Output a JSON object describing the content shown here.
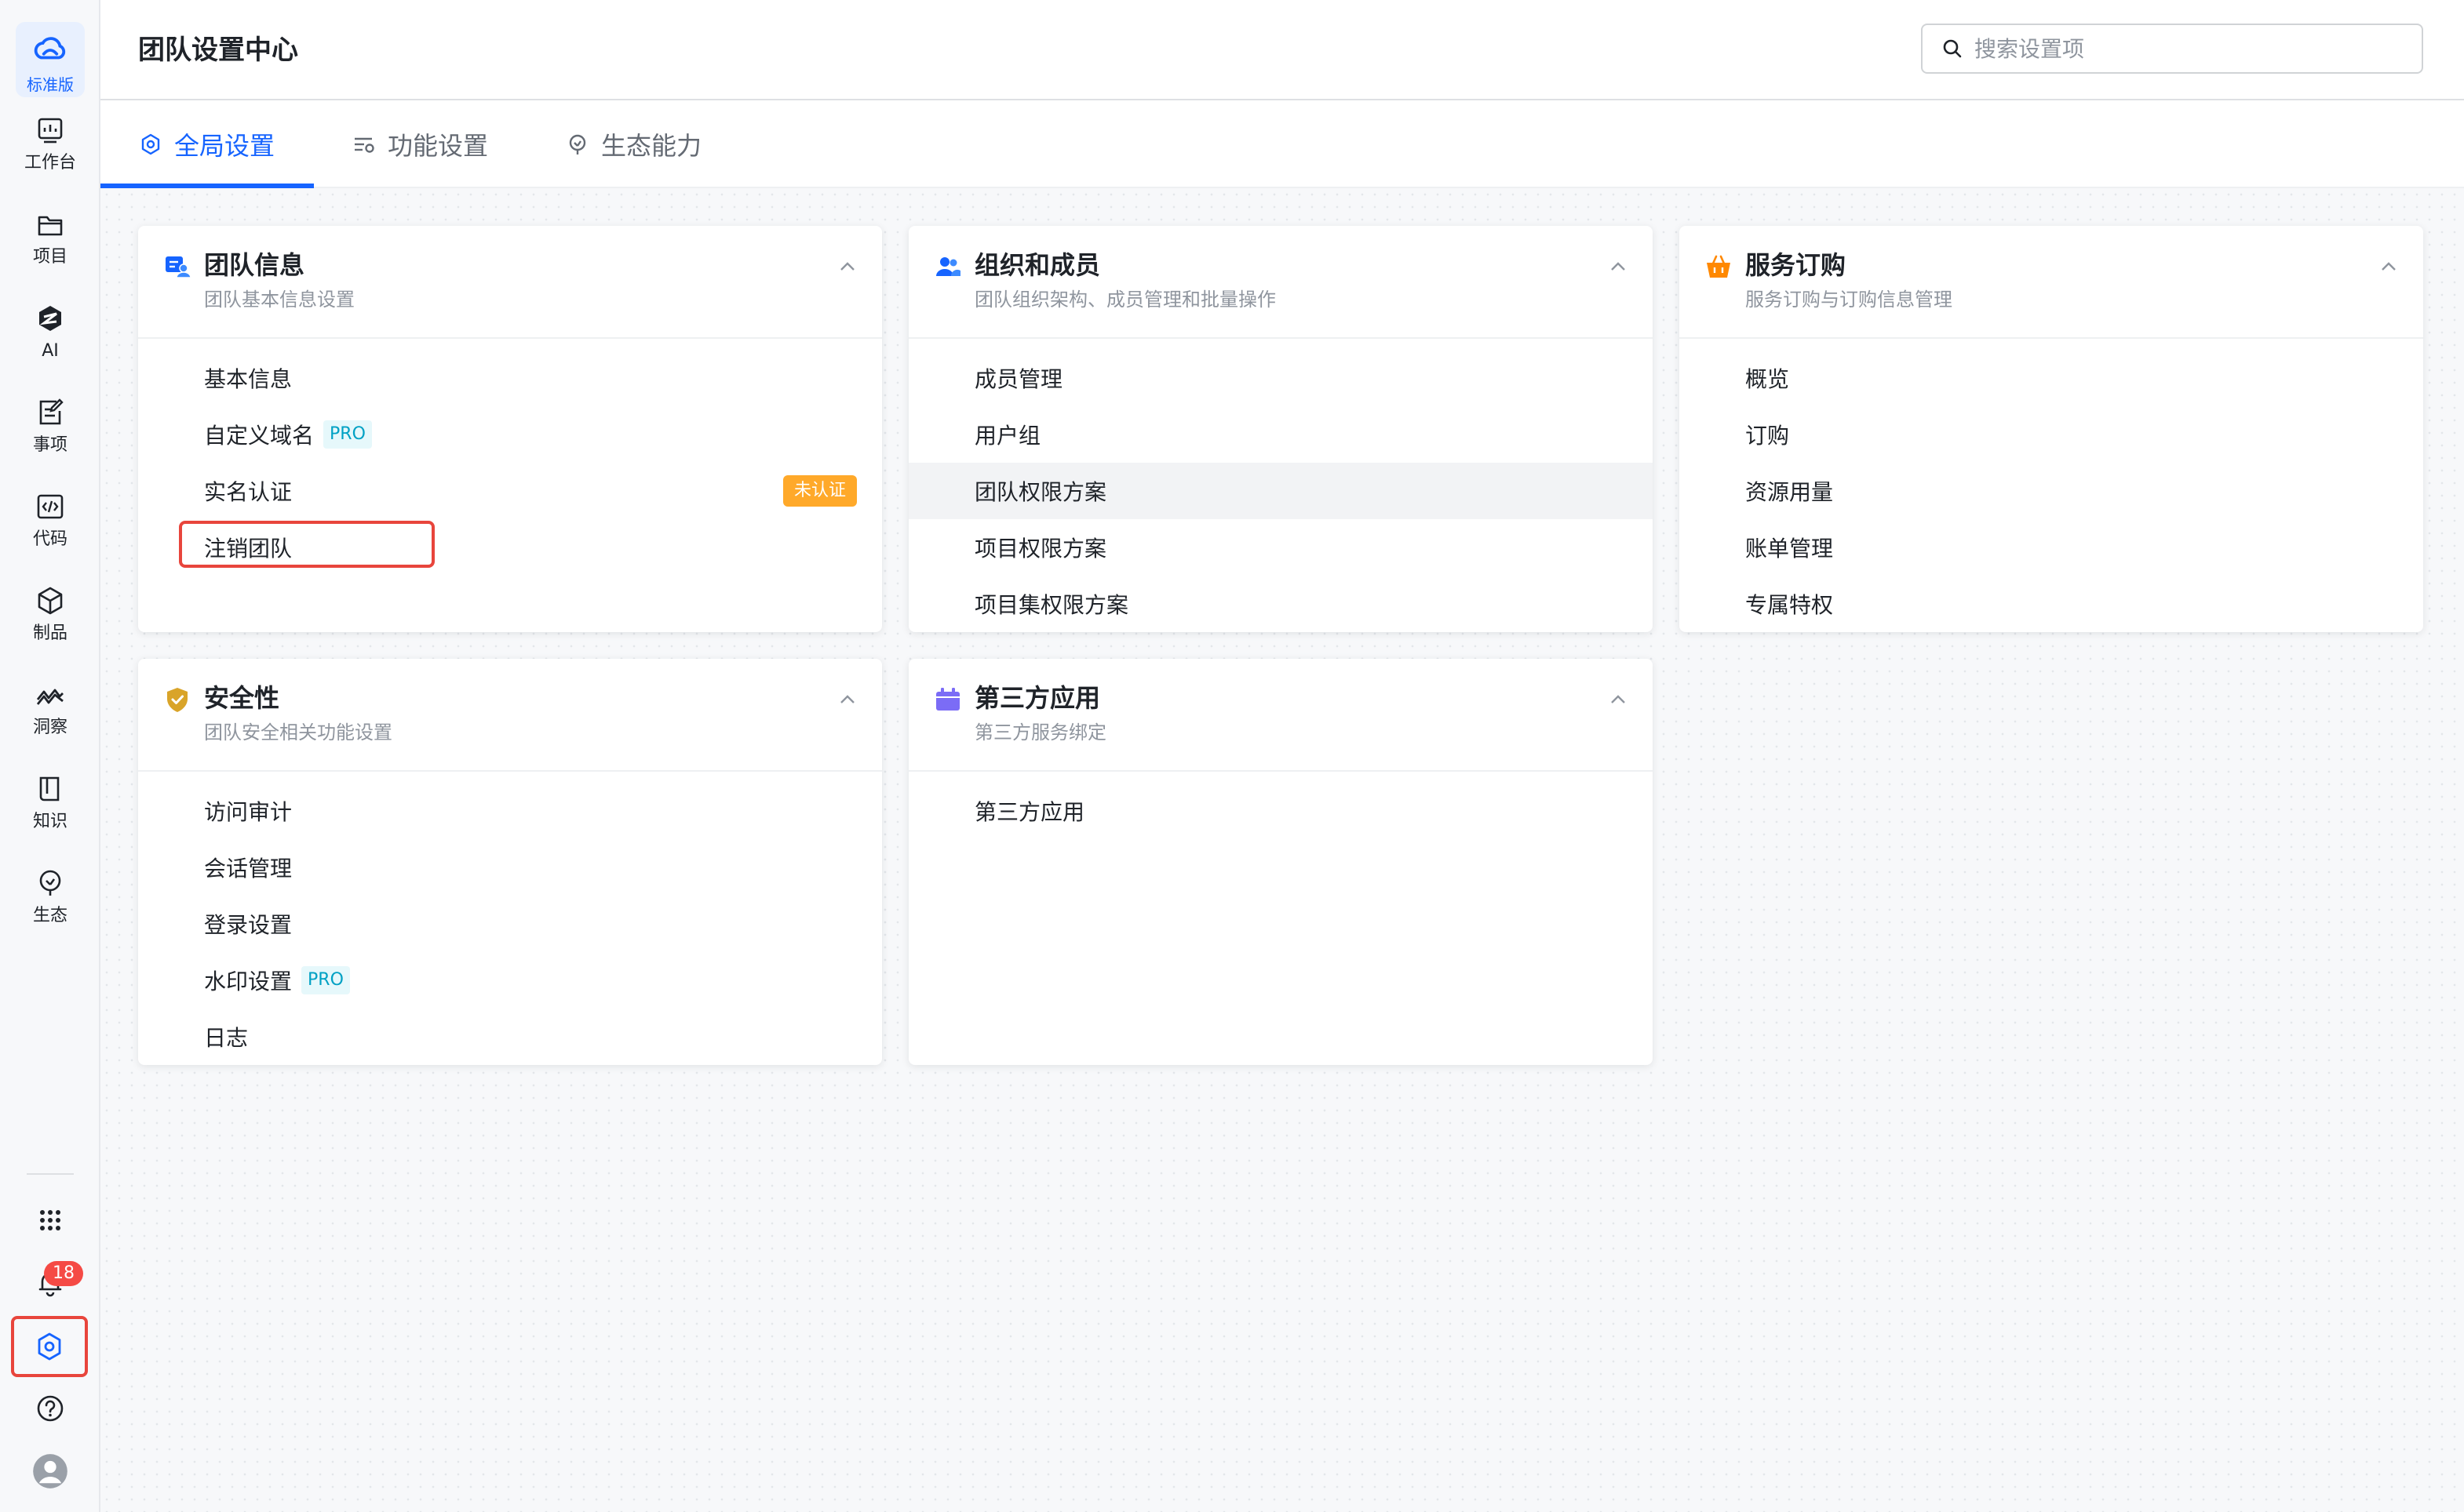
{
  "rail": {
    "logo_label": "标准版",
    "items": [
      {
        "label": "工作台",
        "icon": "dashboard-icon"
      },
      {
        "label": "项目",
        "icon": "folder-icon"
      },
      {
        "label": "AI",
        "icon": "ai-icon"
      },
      {
        "label": "事项",
        "icon": "task-icon"
      },
      {
        "label": "代码",
        "icon": "code-icon"
      },
      {
        "label": "制品",
        "icon": "package-icon"
      },
      {
        "label": "洞察",
        "icon": "insight-icon"
      },
      {
        "label": "知识",
        "icon": "book-icon"
      },
      {
        "label": "生态",
        "icon": "ecosystem-icon"
      }
    ],
    "notification_count": "18"
  },
  "header": {
    "title": "团队设置中心",
    "search_placeholder": "搜索设置项"
  },
  "tabs": [
    {
      "label": "全局设置",
      "active": true
    },
    {
      "label": "功能设置",
      "active": false
    },
    {
      "label": "生态能力",
      "active": false
    }
  ],
  "cards": {
    "team_info": {
      "title": "团队信息",
      "subtitle": "团队基本信息设置",
      "items": [
        "基本信息",
        "自定义域名",
        "实名认证",
        "注销团队"
      ],
      "pro_badge": "PRO",
      "unverified_badge": "未认证"
    },
    "org_members": {
      "title": "组织和成员",
      "subtitle": "团队组织架构、成员管理和批量操作",
      "items": [
        "成员管理",
        "用户组",
        "团队权限方案",
        "项目权限方案",
        "项目集权限方案"
      ]
    },
    "service": {
      "title": "服务订购",
      "subtitle": "服务订购与订购信息管理",
      "items": [
        "概览",
        "订购",
        "资源用量",
        "账单管理",
        "专属特权"
      ]
    },
    "security": {
      "title": "安全性",
      "subtitle": "团队安全相关功能设置",
      "items": [
        "访问审计",
        "会话管理",
        "登录设置",
        "水印设置",
        "日志"
      ],
      "pro_badge": "PRO"
    },
    "third_party": {
      "title": "第三方应用",
      "subtitle": "第三方服务绑定",
      "items": [
        "第三方应用"
      ]
    }
  },
  "colors": {
    "accent": "#1664ff",
    "highlight": "#e8453c",
    "pro_text": "#00a1c4",
    "warning": "#ffa92a"
  }
}
